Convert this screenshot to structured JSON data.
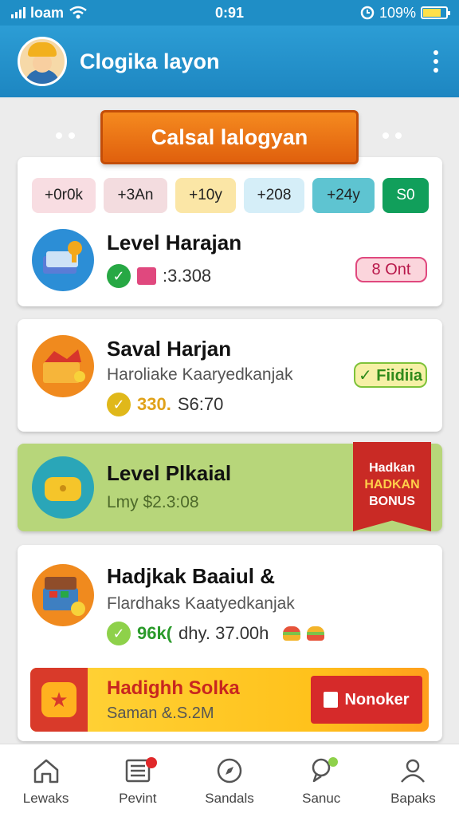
{
  "status_bar": {
    "carrier": "loam",
    "time": "0:91",
    "battery": "109%"
  },
  "header": {
    "title": "Clogika layon",
    "menu_icon": "more-vertical-icon"
  },
  "banner": {
    "label": "Calsal lalogyan"
  },
  "chips": [
    {
      "label": "+0r0k",
      "bg": "#f8dde2"
    },
    {
      "label": "+3An",
      "bg": "#f3dcdf"
    },
    {
      "label": "+10y",
      "bg": "#fbe6a6"
    },
    {
      "label": "+208",
      "bg": "#d5eef8"
    },
    {
      "label": "+24y",
      "bg": "#5ec4d1"
    },
    {
      "label": "S0",
      "bg": "#119f5b",
      "color": "#ffffff"
    }
  ],
  "items": [
    {
      "title": "Level Harajan",
      "value": ":3.308",
      "badge": "8 Ont",
      "icon": "certificate-icon"
    },
    {
      "title": "Saval Harjan",
      "subtitle": "Haroliake Kaaryedkanjak",
      "value_highlight": "330.",
      "value": "S6:70",
      "badge": "✓ Fiidiia",
      "icon": "treasure-box-icon"
    },
    {
      "title": "Level Plkaial",
      "value": "Lmy $2.3:08",
      "ribbon": {
        "line1": "Hadkan",
        "line2": "HADKAN",
        "line3": "BONUS"
      },
      "icon": "chest-icon"
    },
    {
      "title": "Hadjkak Baaiul &",
      "subtitle": "Flardhaks Kaatyedkanjak",
      "value_highlight": "96k(",
      "value": "dhy. 37.00h",
      "icon": "treasure-chest-icon"
    }
  ],
  "promo": {
    "title": "Hadighh Solka",
    "subtitle": "Saman &.S.2M",
    "button": "Nonoker",
    "icon": "star-icon"
  },
  "tabs": [
    {
      "label": "Lewaks",
      "icon": "home-icon"
    },
    {
      "label": "Pevint",
      "icon": "list-icon"
    },
    {
      "label": "Sandals",
      "icon": "compass-icon"
    },
    {
      "label": "Sanuc",
      "icon": "pin-icon"
    },
    {
      "label": "Bapaks",
      "icon": "user-icon"
    }
  ],
  "colors": {
    "primary": "#1f8ec6",
    "accent": "#f58a1f",
    "green": "#119f5b",
    "red": "#c92a25"
  }
}
